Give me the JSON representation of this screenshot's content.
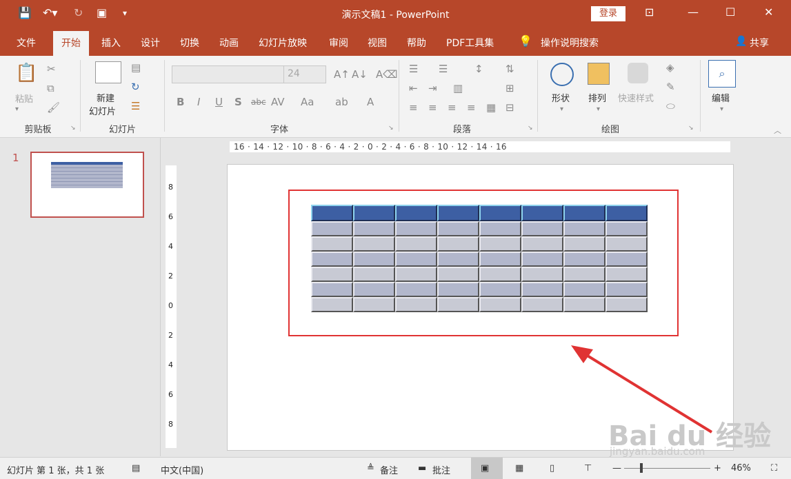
{
  "title": "演示文稿1 - PowerPoint",
  "titlebar": {
    "login": "登录"
  },
  "tabs": [
    "文件",
    "开始",
    "插入",
    "设计",
    "切换",
    "动画",
    "幻灯片放映",
    "审阅",
    "视图",
    "帮助",
    "PDF工具集"
  ],
  "tell_me": "操作说明搜索",
  "share": "共享",
  "ribbon": {
    "clipboard": {
      "label": "剪贴板",
      "paste": "粘贴"
    },
    "slides": {
      "label": "幻灯片",
      "new_slide_1": "新建",
      "new_slide_2": "幻灯片"
    },
    "font": {
      "label": "字体",
      "size": "24"
    },
    "paragraph": {
      "label": "段落"
    },
    "drawing": {
      "label": "绘图",
      "shapes": "形状",
      "arrange": "排列",
      "quick_styles": "快速样式"
    },
    "editing": {
      "edit": "编辑"
    }
  },
  "thumbnail": {
    "number": "1"
  },
  "ruler_h": "16 · 14 · 12 · 10 · 8 · 6 · 4 · 2 · 0 · 2 · 4 · 6 · 8 · 10 · 12 · 14 · 16",
  "ruler_v": [
    "8",
    "6",
    "4",
    "2",
    "0",
    "2",
    "4",
    "6",
    "8"
  ],
  "table": {
    "columns": 8,
    "rows": 7
  },
  "status": {
    "slide_info": "幻灯片 第 1 张，共 1 张",
    "language": "中文(中国)",
    "notes": "备注",
    "comments": "批注",
    "zoom": "46%"
  },
  "watermark": {
    "brand": "Bai du 经验",
    "url": "jingyan.baidu.com"
  },
  "colors": {
    "accent": "#b7472a",
    "header_cell": "#3d5fa3",
    "highlight": "#e03333"
  }
}
